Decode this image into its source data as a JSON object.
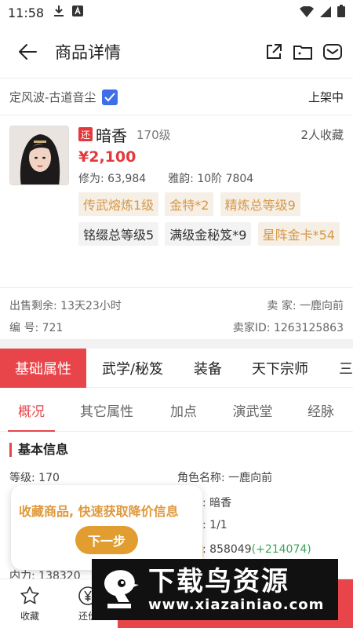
{
  "status_bar": {
    "time": "11:58"
  },
  "app_bar": {
    "title": "商品详情"
  },
  "shop": {
    "server": "定风波-古道音尘",
    "status": "上架中"
  },
  "item": {
    "badge": "还",
    "name": "暗香",
    "level": "170级",
    "favorites": "2人收藏",
    "price": "¥2,100",
    "xiuwei": "修为: 63,984",
    "yayun": "雅韵: 10阶 7804",
    "tags": [
      {
        "text": "传武熔炼1级",
        "style": "gold"
      },
      {
        "text": "金特*2",
        "style": "gold"
      },
      {
        "text": "精炼总等级9",
        "style": "gold"
      },
      {
        "text": "铭缀总等级5",
        "style": "plain"
      },
      {
        "text": "满级金秘笈*9",
        "style": "plain"
      },
      {
        "text": "星阵金卡*54",
        "style": "gold"
      }
    ]
  },
  "trade": {
    "remaining": "出售剩余: 13天23小时",
    "seller": "卖  家: 一鹿向前",
    "number": "编  号: 721",
    "seller_id": "卖家ID: 1263125863"
  },
  "tabs_primary": [
    "基础属性",
    "武学/秘笈",
    "装备",
    "天下宗师",
    "三"
  ],
  "tabs_secondary": [
    "概况",
    "其它属性",
    "加点",
    "演武堂",
    "经脉"
  ],
  "basic_info": {
    "title": "基本信息",
    "level": "等级: 170",
    "role_name": "角色名称: 一鹿向前",
    "char_name": ": 暗香",
    "ratio": ": 1/1",
    "value_main": ": 858049",
    "value_delta": "(+214074)",
    "neili": "内力: 138320"
  },
  "tooltip": {
    "text": "收藏商品, 快速获取降价信息",
    "button": "下一步"
  },
  "bottom_bar": {
    "favorite": "收藏",
    "bargain": "还价"
  },
  "watermark": {
    "title": "下载鸟资源",
    "url": "www.xiazainiao.com"
  },
  "colors": {
    "accent": "#e8454a",
    "price": "#e4393c",
    "tag_bg": "#f6efe6",
    "tag_text": "#d69846",
    "checkbox": "#3e6ee8"
  }
}
